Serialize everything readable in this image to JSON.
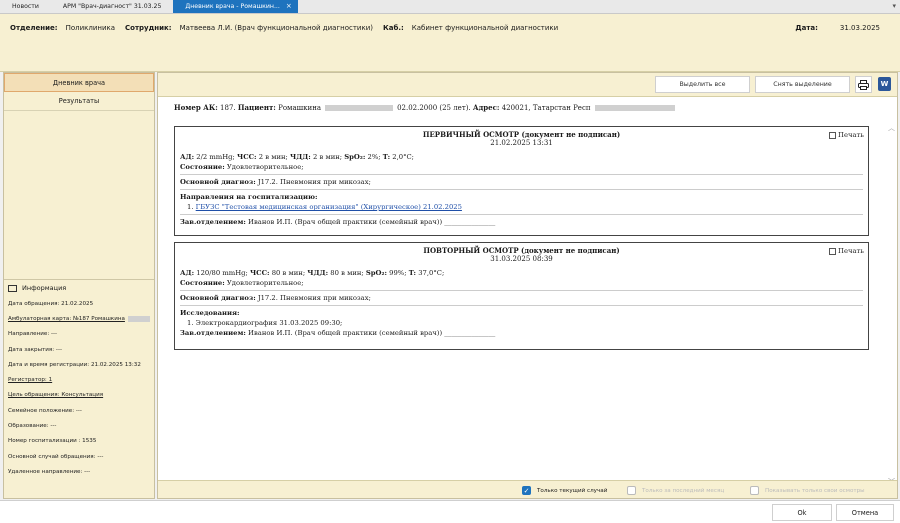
{
  "tabs": [
    {
      "label": "Новости"
    },
    {
      "label": "АРМ \"Врач-диагност\" 31.03.25"
    },
    {
      "label": "Дневник врача - Ромашкин..."
    }
  ],
  "header": {
    "dept_label": "Отделение:",
    "dept_value": "Поликлиника",
    "employee_label": "Сотрудник:",
    "employee_value": "Матвеева Л.И. (Врач функциональной диагностики)",
    "cabinet_label": "Каб.:",
    "cabinet_value": "Кабинет функциональной диагностики",
    "date_label": "Дата:",
    "date_value": "31.03.2025"
  },
  "nav": {
    "diary": "Дневник врача",
    "results": "Результаты"
  },
  "info": {
    "title": "Информация",
    "lines": [
      "Дата обращения: 21.02.2025",
      "Амбулаторная карта: №187 Ромашкина",
      "Направление: ---",
      "Дата закрытия: ---",
      "Дата и время регистрации: 21.02.2025 13:32",
      "Регистратор: 1",
      "Цель обращения: Консультация",
      "Семейное положение: ---",
      "Образование: ---",
      "Номер госпитализации : 1535",
      "Основной случай обращения: ---",
      "Удаленное направление: ---"
    ]
  },
  "toolbar": {
    "select_all": "Выделить все",
    "deselect": "Снять выделение",
    "word_icon": "W"
  },
  "patient": {
    "ak_label": "Номер АК:",
    "ak_value": "187.",
    "patient_label": "Пациент:",
    "patient_value": "Ромашкина",
    "birth": "02.02.2000 (25 лет).",
    "address_label": "Адрес:",
    "address_value": "420021, Татарстан Респ"
  },
  "docs": [
    {
      "title": "ПЕРВИЧНЫЙ ОСМОТР (документ не подписан)",
      "date": "21.02.2025 13:31",
      "print_label": "Печать",
      "vitals_pre": "АД:",
      "vitals": "2/2 mmHg;",
      "hss_label": "ЧСС:",
      "hss": "2 в мин;",
      "chdd_label": "ЧДД:",
      "chdd": "2 в мин;",
      "spo_label": "SpO₂:",
      "spo": "2%;",
      "t_label": "T:",
      "t": "2,0°C;",
      "state_label": "Состояние:",
      "state": "Удовлетворительное;",
      "diag_label": "Основной диагноз:",
      "diag": "J17.2. Пневмония при микозах;",
      "dir_label": "Направления на госпитализацию:",
      "dir_item_num": "1.",
      "dir_item": "ГБУЗС \"Тестовая медицинская организация\" (Хирургическое) 21.02.2025",
      "head_label": "Зав.отделением:",
      "head_value": "Иванов И.П. (Врач общей практики (семейный врач)) _______________"
    },
    {
      "title": "ПОВТОРНЫЙ ОСМОТР (документ не подписан)",
      "date": "31.03.2025 08:39",
      "print_label": "Печать",
      "vitals_pre": "АД:",
      "vitals": "120/80 mmHg;",
      "hss_label": "ЧСС:",
      "hss": "80 в мин;",
      "chdd_label": "ЧДД:",
      "chdd": "80 в мин;",
      "spo_label": "SpO₂:",
      "spo": "99%;",
      "t_label": "T:",
      "t": "37,0°C;",
      "state_label": "Состояние:",
      "state": "Удовлетворительное;",
      "diag_label": "Основной диагноз:",
      "diag": "J17.2. Пневмония при микозах;",
      "res_label": "Исследования:",
      "res_item": "1. Электрокардиография 31.03.2025 09:30;",
      "head_label": "Зав.отделением:",
      "head_value": "Иванов И.П. (Врач общей практики (семейный врач)) _______________"
    }
  ],
  "footer": {
    "current_case": "Только текущий случай",
    "last_month": "Только за последний месяц",
    "own_only": "Показывать только свои осмотры"
  },
  "buttons": {
    "ok": "Ok",
    "cancel": "Отмена"
  }
}
